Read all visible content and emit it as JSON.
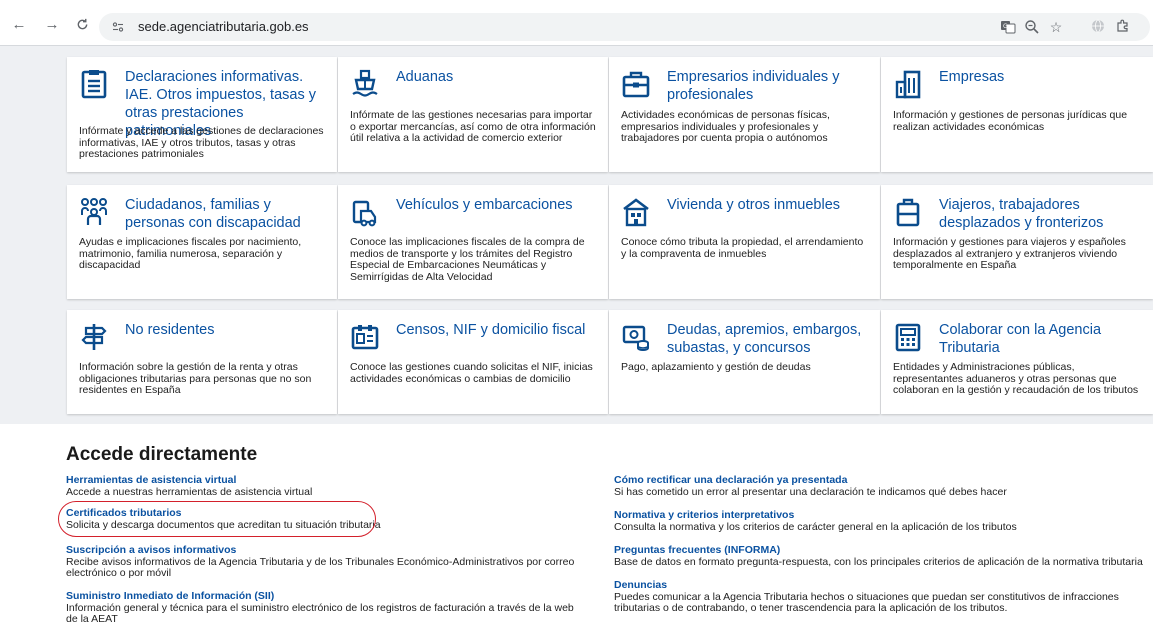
{
  "browser": {
    "url": "sede.agenciatributaria.gob.es"
  },
  "cards": [
    {
      "title": "Declaraciones informativas. IAE. Otros impuestos, tasas y otras prestaciones patrimoniales",
      "desc": "Infórmate y accede a las gestiones de declaraciones informativas, IAE y otros tributos, tasas y otras prestaciones patrimoniales",
      "icon": "document-list-icon"
    },
    {
      "title": "Aduanas",
      "desc": "Infórmate de las gestiones necesarias para importar o exportar mercancías, así como de otra información útil relativa a la actividad de comercio exterior",
      "icon": "ship-icon"
    },
    {
      "title": "Empresarios individuales y profesionales",
      "desc": "Actividades económicas de personas físicas, empresarios individuales y profesionales y trabajadores por cuenta propia o autónomos",
      "icon": "briefcase-icon"
    },
    {
      "title": "Empresas",
      "desc": "Información y gestiones de personas jurídicas que realizan actividades económicas",
      "icon": "building-icon"
    },
    {
      "title": "Ciudadanos, familias y personas con discapacidad",
      "desc": "Ayudas e implicaciones fiscales por nacimiento, matrimonio, familia numerosa, separación y discapacidad",
      "icon": "family-icon"
    },
    {
      "title": "Vehículos y embarcaciones",
      "desc": "Conoce las implicaciones fiscales de la compra de medios de transporte y los trámites del Registro Especial de Embarcaciones Neumáticas y Semirrígidas de Alta Velocidad",
      "icon": "vehicle-icon"
    },
    {
      "title": "Vivienda y otros inmuebles",
      "desc": "Conoce cómo tributa la propiedad, el arrendamiento y la compraventa de inmuebles",
      "icon": "house-icon"
    },
    {
      "title": "Viajeros, trabajadores desplazados y fronterizos",
      "desc": "Información y gestiones para viajeros y españoles desplazados al extranjero y extranjeros viviendo temporalmente en España",
      "icon": "luggage-icon"
    },
    {
      "title": "No residentes",
      "desc": "Información sobre la gestión de la renta y otras obligaciones tributarias para personas que no son residentes en España",
      "icon": "signpost-icon"
    },
    {
      "title": "Censos, NIF y domicilio fiscal",
      "desc": "Conoce las gestiones cuando solicitas el NIF, inicias actividades económicas o cambias de domicilio",
      "icon": "id-card-icon"
    },
    {
      "title": "Deudas, apremios, embargos, subastas, y concursos",
      "desc": "Pago, aplazamiento y gestión de deudas",
      "icon": "money-icon"
    },
    {
      "title": "Colaborar con la Agencia Tributaria",
      "desc": "Entidades y Administraciones públicas, representantes aduaneros y otras personas que colaboran en la gestión y recaudación de los tributos",
      "icon": "calculator-icon"
    }
  ],
  "direct": {
    "heading": "Accede directamente",
    "left": [
      {
        "title": "Herramientas de asistencia virtual",
        "desc": "Accede a nuestras herramientas de asistencia virtual"
      },
      {
        "title": "Certificados tributarios",
        "desc": "Solicita y descarga documentos que acreditan tu situación tributaria"
      },
      {
        "title": "Suscripción a avisos informativos",
        "desc": "Recibe avisos informativos de la Agencia Tributaria y de los Tribunales Económico-Administrativos por correo electrónico o por móvil"
      },
      {
        "title": "Suministro Inmediato de Información (SII)",
        "desc": "Información general y técnica para el suministro electrónico de los registros de facturación a través de la web de la AEAT"
      }
    ],
    "right": [
      {
        "title": "Cómo rectificar una declaración ya presentada",
        "desc": "Si has cometido un error al presentar una declaración te indicamos qué debes hacer"
      },
      {
        "title": "Normativa y criterios interpretativos",
        "desc": "Consulta la normativa y los criterios de carácter general en la aplicación de los tributos"
      },
      {
        "title": "Preguntas frecuentes (INFORMA)",
        "desc": "Base de datos en formato pregunta-respuesta, con los principales criterios de aplicación de la normativa tributaria"
      },
      {
        "title": "Denuncias",
        "desc": "Puedes comunicar a la Agencia Tributaria hechos o situaciones que puedan ser constitutivos de infracciones tributarias o de contrabando, o tener trascendencia para la aplicación de los tributos."
      }
    ]
  },
  "colors": {
    "accent": "#0b52a1",
    "highlight": "#d3202b"
  }
}
